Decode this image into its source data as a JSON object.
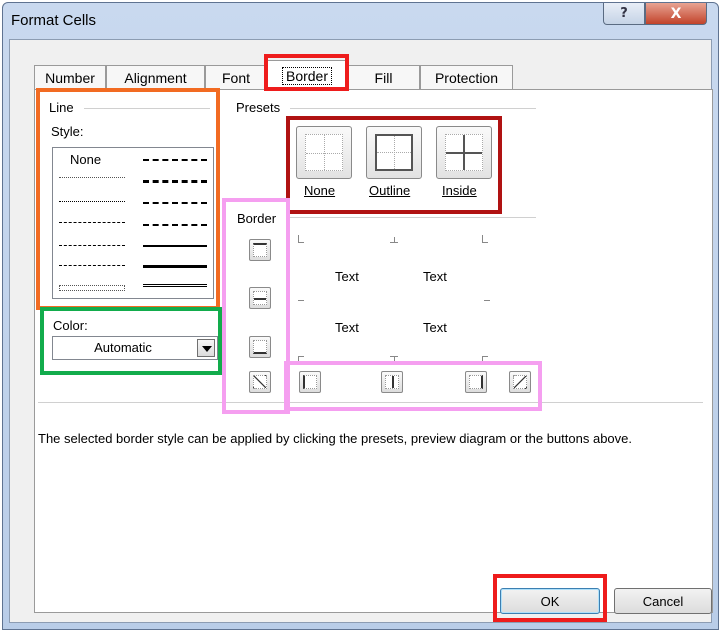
{
  "window": {
    "title": "Format Cells",
    "help_icon": "?",
    "close_icon": "X"
  },
  "tabs": [
    {
      "label": "Number"
    },
    {
      "label": "Alignment"
    },
    {
      "label": "Font"
    },
    {
      "label": "Border",
      "active": true
    },
    {
      "label": "Fill"
    },
    {
      "label": "Protection"
    }
  ],
  "line": {
    "group_label": "Line",
    "style_label": "Style:",
    "style_none": "None",
    "color_label": "Color:",
    "color_value": "Automatic"
  },
  "presets": {
    "group_label": "Presets",
    "items": [
      {
        "label": "None"
      },
      {
        "label": "Outline"
      },
      {
        "label": "Inside"
      }
    ]
  },
  "border": {
    "group_label": "Border",
    "preview_text": [
      "Text",
      "Text",
      "Text",
      "Text"
    ]
  },
  "description": "The selected border style can be applied by clicking the presets, preview diagram or the buttons above.",
  "buttons": {
    "ok": "OK",
    "cancel": "Cancel"
  },
  "highlight_colors": {
    "red": "#ee1c1c",
    "orange": "#f26b22",
    "green": "#12ac4c",
    "dark_red": "#b01212",
    "pink": "#f59ff0"
  }
}
